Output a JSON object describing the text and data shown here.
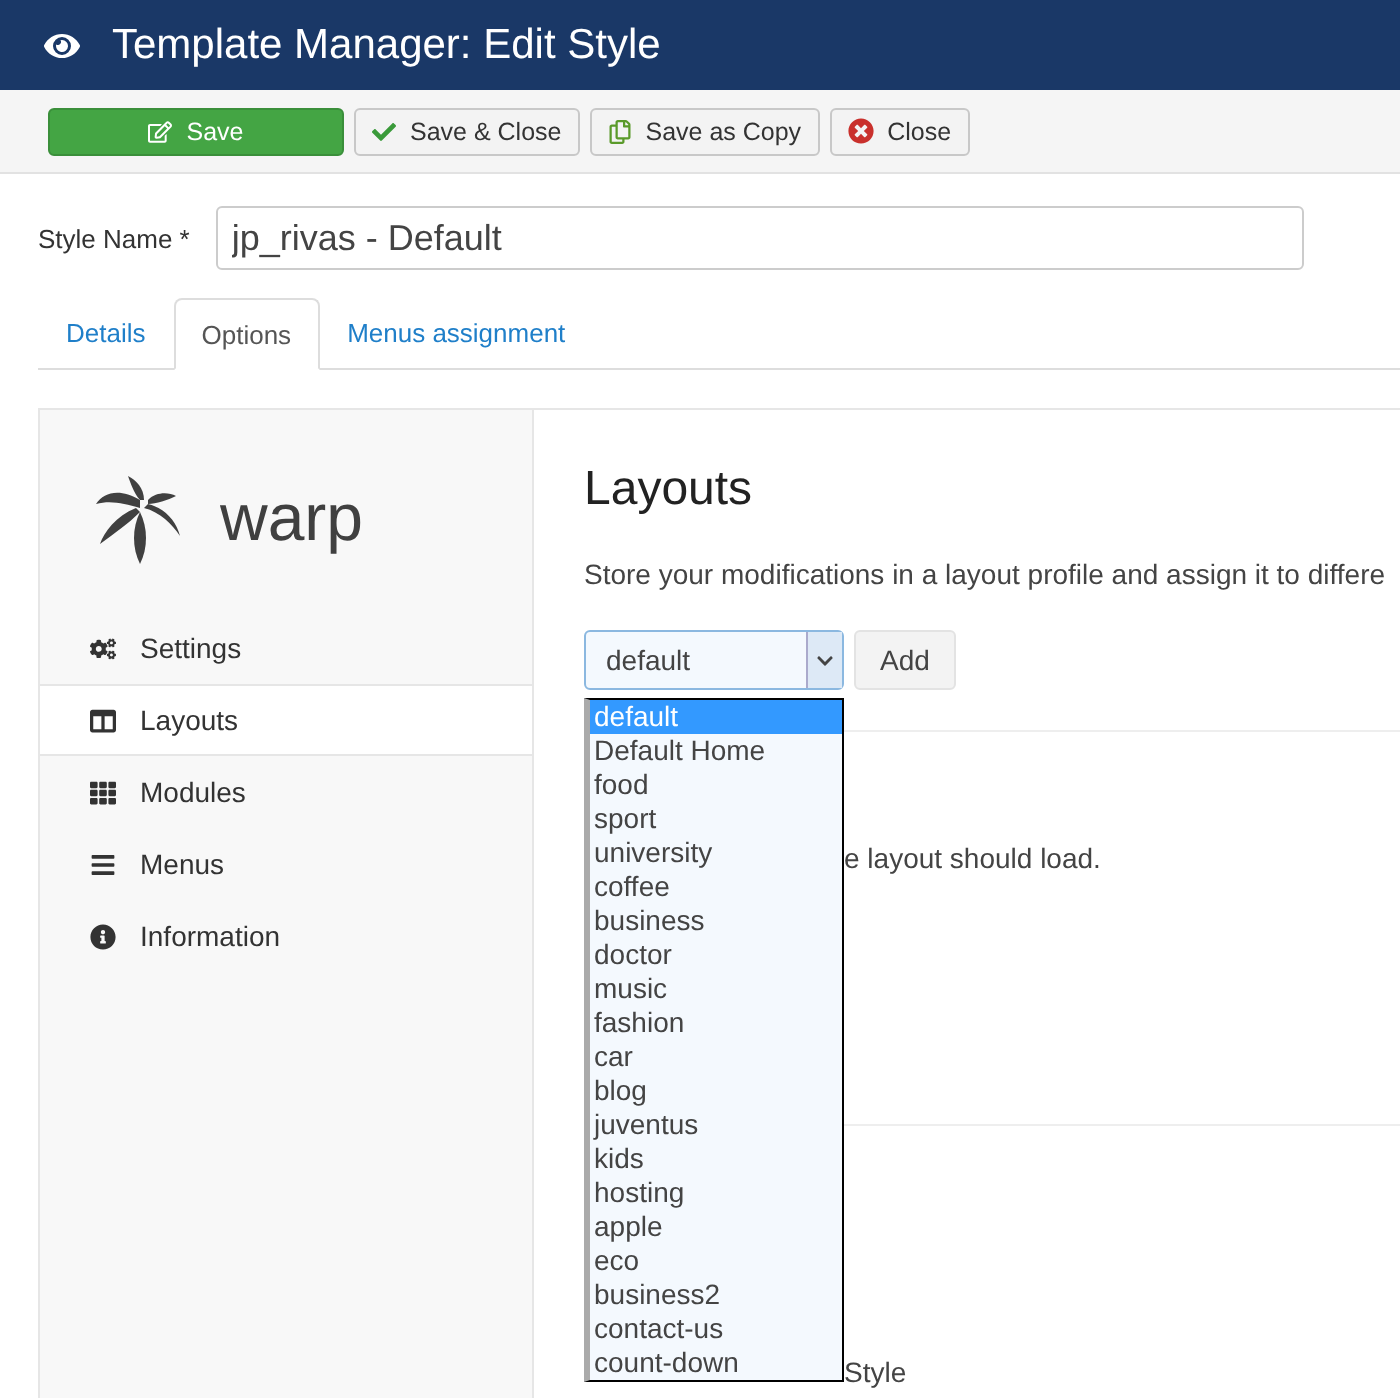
{
  "header": {
    "title": "Template Manager: Edit Style"
  },
  "toolbar": [
    {
      "kind": "save",
      "label": "Save"
    },
    {
      "kind": "check",
      "label": "Save & Close"
    },
    {
      "kind": "copy",
      "label": "Save as Copy"
    },
    {
      "kind": "close",
      "label": "Close"
    }
  ],
  "style_name": {
    "label": "Style Name *",
    "value": "jp_rivas - Default"
  },
  "tabs": [
    {
      "label": "Details",
      "selected": false
    },
    {
      "label": "Options",
      "selected": true
    },
    {
      "label": "Menus assignment",
      "selected": false
    }
  ],
  "sidebar": {
    "logo": "warp",
    "items": [
      {
        "kind": "settings",
        "label": "Settings",
        "selected": false
      },
      {
        "kind": "layouts",
        "label": "Layouts",
        "selected": true
      },
      {
        "kind": "modules",
        "label": "Modules",
        "selected": false
      },
      {
        "kind": "menus",
        "label": "Menus",
        "selected": false
      },
      {
        "kind": "information",
        "label": "Information",
        "selected": false
      }
    ]
  },
  "main": {
    "heading": "Layouts",
    "description": "Store your modifications in a layout profile and assign it to differe",
    "select": {
      "value": "default",
      "options": [
        {
          "label": "default",
          "selected": true
        },
        {
          "label": "Default Home",
          "selected": false
        },
        {
          "label": "food",
          "selected": false
        },
        {
          "label": "sport",
          "selected": false
        },
        {
          "label": "university",
          "selected": false
        },
        {
          "label": "coffee",
          "selected": false
        },
        {
          "label": "business",
          "selected": false
        },
        {
          "label": "doctor",
          "selected": false
        },
        {
          "label": "music",
          "selected": false
        },
        {
          "label": "fashion",
          "selected": false
        },
        {
          "label": "car",
          "selected": false
        },
        {
          "label": "blog",
          "selected": false
        },
        {
          "label": "juventus",
          "selected": false
        },
        {
          "label": "kids",
          "selected": false
        },
        {
          "label": "hosting",
          "selected": false
        },
        {
          "label": "apple",
          "selected": false
        },
        {
          "label": "eco",
          "selected": false
        },
        {
          "label": "business2",
          "selected": false
        },
        {
          "label": "contact-us",
          "selected": false
        },
        {
          "label": "count-down",
          "selected": false
        }
      ]
    },
    "add_button": "Add",
    "sections": [
      {
        "text": "e layout should load."
      },
      {
        "text": "Style"
      }
    ]
  }
}
